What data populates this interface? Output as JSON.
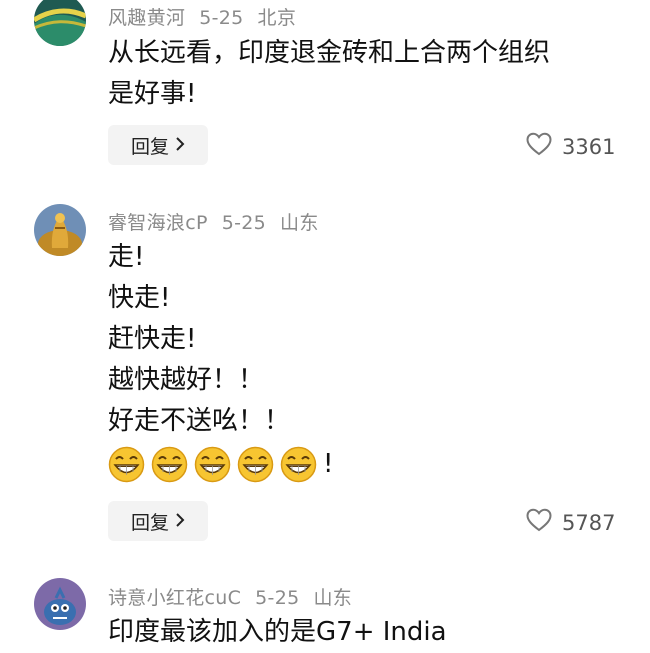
{
  "comments": [
    {
      "user": "风趣黄河",
      "date": "5-25",
      "location": "北京",
      "lines": [
        "从长远看，印度退金砖和上合两个组织",
        "是好事!"
      ],
      "reply_label": "回复",
      "likes": "3361"
    },
    {
      "user": "睿智海浪cP",
      "date": "5-25",
      "location": "山东",
      "lines": [
        "走!",
        "快走!",
        "赶快走!",
        "越快越好！！",
        "好走不送吆！！"
      ],
      "emoji_count": 5,
      "emoji_suffix": "!",
      "reply_label": "回复",
      "likes": "5787"
    },
    {
      "user": "诗意小红花cuC",
      "date": "5-25",
      "location": "山东",
      "lines": [
        "印度最该加入的是G7+ India"
      ]
    }
  ],
  "icons": {
    "reply_chevron": "chevron-right-icon",
    "like": "heart-outline-icon",
    "emoji": "grinning-face-icon"
  },
  "colors": {
    "meta": "#8a8a8a",
    "button_bg": "#f3f3f3",
    "text": "#111111"
  }
}
